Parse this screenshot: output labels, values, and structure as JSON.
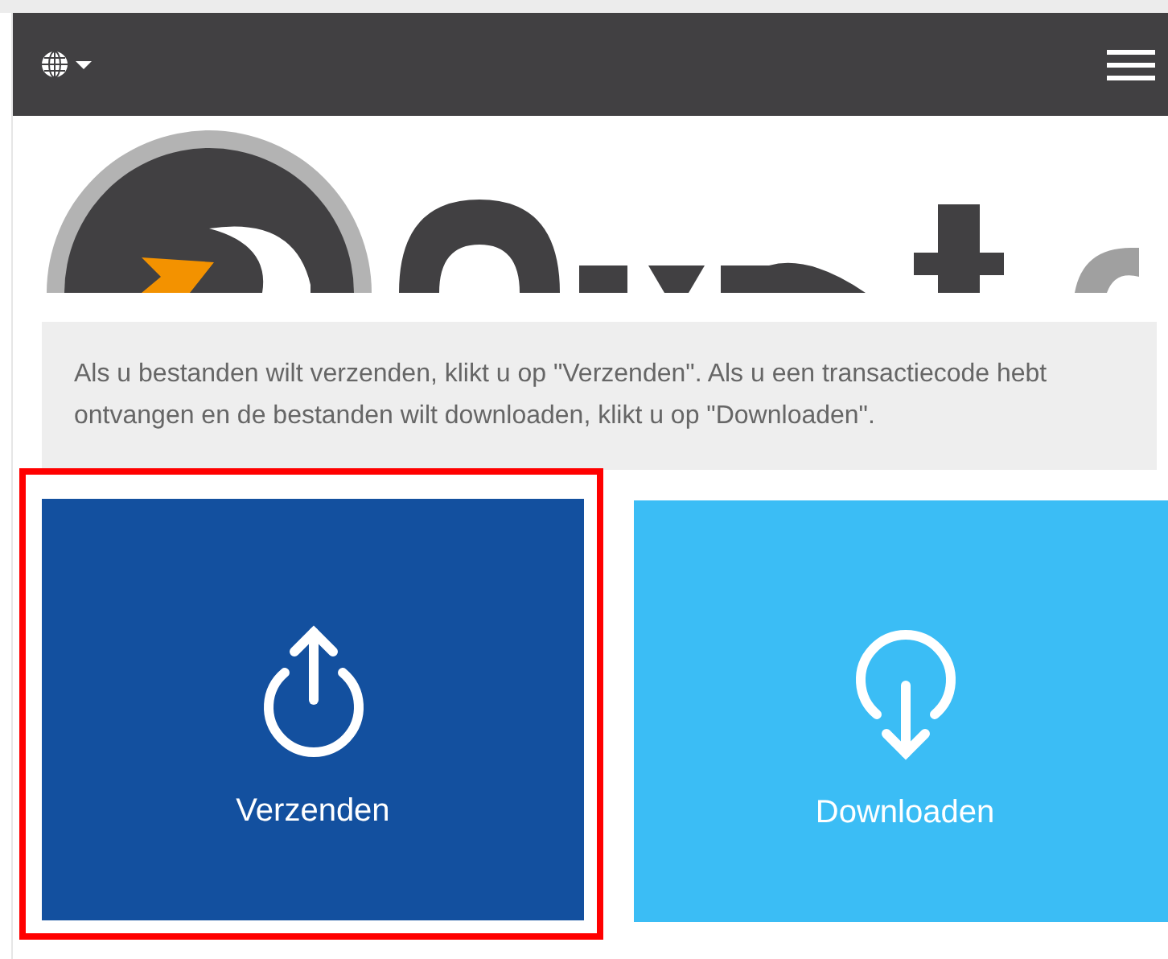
{
  "info": "Als u bestanden wilt verzenden, klikt u op \"Verzenden\". Als u een transactiecode hebt ontvangen en de bestanden wilt downloaden, klikt u op \"Downloaden\".",
  "tiles": [
    {
      "kind": "upload",
      "label": "Verzenden",
      "color": "#13509f",
      "highlighted": true
    },
    {
      "kind": "download",
      "label": "Downloaden",
      "color": "#3bbdf5",
      "highlighted": false
    }
  ]
}
